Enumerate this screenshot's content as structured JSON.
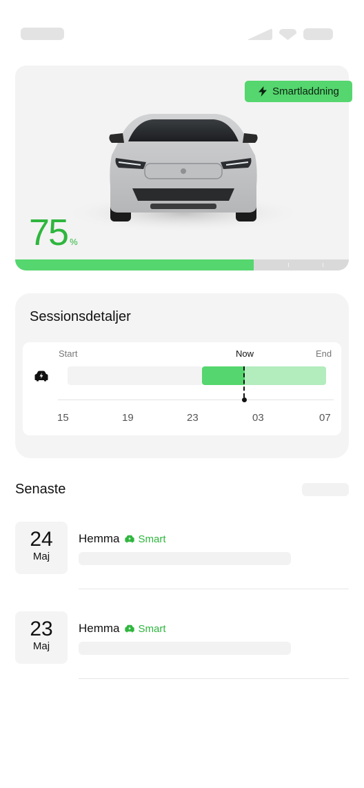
{
  "status_bar": {
    "icons": [
      "signal-icon",
      "wifi-icon",
      "battery-icon"
    ]
  },
  "hero": {
    "badge_label": "Smartladdning",
    "badge_icon": "bolt-icon",
    "battery_value": "75",
    "battery_unit": "%",
    "battery_level": 0.715,
    "accent_color": "#55d66e"
  },
  "session": {
    "title": "Sessionsdetaljer",
    "label_start": "Start",
    "label_now": "Now",
    "label_end": "End",
    "hours": [
      "15",
      "19",
      "23",
      "03",
      "07"
    ],
    "car_icon": "car-charging-icon"
  },
  "recent": {
    "title": "Senaste",
    "items": [
      {
        "day": "24",
        "month": "Maj",
        "location": "Hemma",
        "tag": "Smart"
      },
      {
        "day": "23",
        "month": "Maj",
        "location": "Hemma",
        "tag": "Smart"
      }
    ]
  }
}
